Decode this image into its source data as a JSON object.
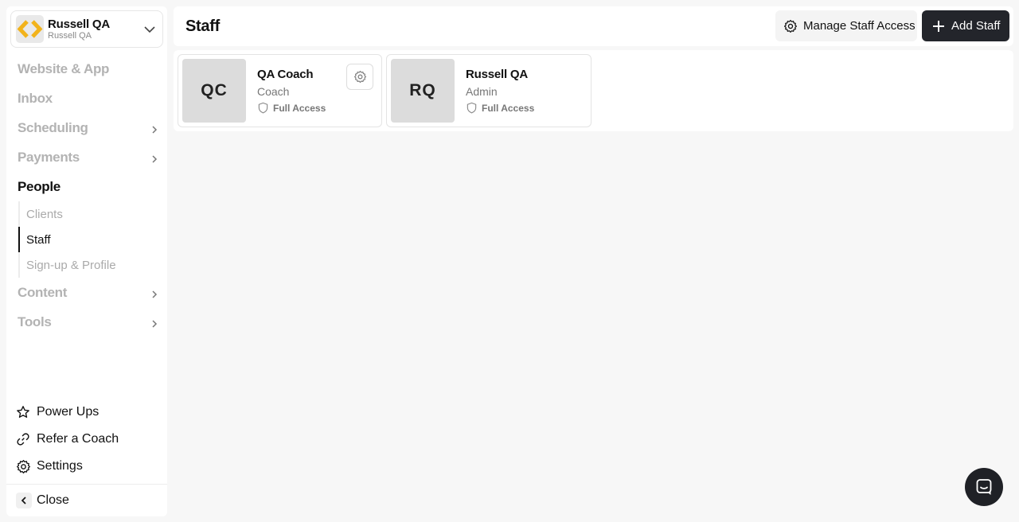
{
  "org": {
    "name": "Russell QA",
    "subtitle": "Russell QA"
  },
  "nav": {
    "website_app": "Website & App",
    "inbox": "Inbox",
    "scheduling": "Scheduling",
    "payments": "Payments",
    "people": "People",
    "people_sub": {
      "clients": "Clients",
      "staff": "Staff",
      "signup_profile": "Sign-up & Profile"
    },
    "content": "Content",
    "tools": "Tools"
  },
  "bottom": {
    "power_ups": "Power Ups",
    "refer": "Refer a Coach",
    "settings": "Settings",
    "close": "Close"
  },
  "header": {
    "title": "Staff",
    "manage_label": "Manage Staff Access",
    "add_label": "Add Staff"
  },
  "staff": [
    {
      "initials": "QC",
      "name": "QA Coach",
      "role": "Coach",
      "access": "Full Access"
    },
    {
      "initials": "RQ",
      "name": "Russell QA",
      "role": "Admin",
      "access": "Full Access"
    }
  ],
  "colors": {
    "primary_button": "#23252b",
    "logo_accent": "#f2b31b",
    "active_nav": "#111111",
    "inactive_nav": "#b3b3b3"
  }
}
